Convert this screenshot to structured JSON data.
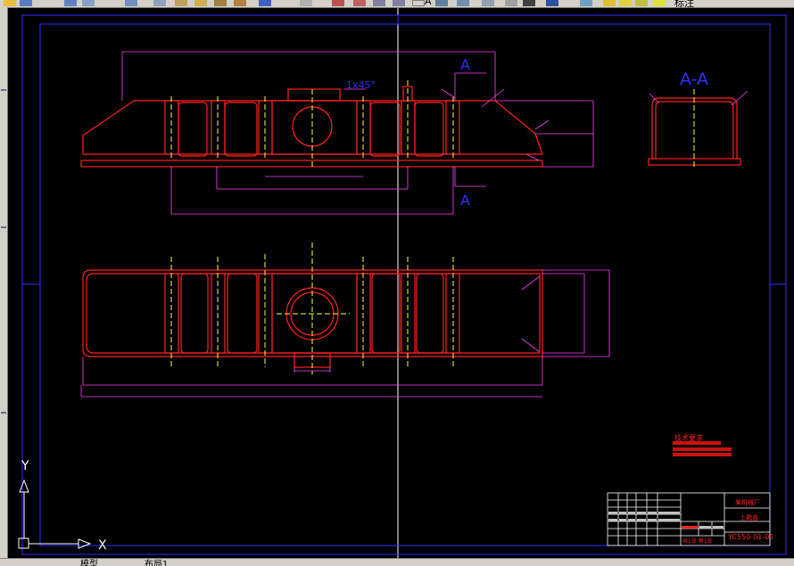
{
  "toolbar": {
    "label_a": "A",
    "label_cn": "标注"
  },
  "drawing": {
    "section_label_top": "A",
    "section_label_bottom": "A",
    "section_title": "A-A",
    "chamfer_note": "1x45°",
    "tech_req_title": "技术要求",
    "title_block": {
      "company": "某机械厂",
      "part_name": "上箱盖",
      "drawing_no": "YC550-01-01",
      "scale_note": "共1张 第1张"
    }
  },
  "ucs": {
    "x_label": "X",
    "y_label": "Y"
  },
  "tabs": {
    "model": "模型",
    "layout": "布局1"
  },
  "colors": {
    "red": "#ff2020",
    "magenta": "#ff40ff",
    "blue": "#3030ff",
    "yellow": "#ffff40",
    "white": "#ffffff",
    "background": "#000000"
  }
}
